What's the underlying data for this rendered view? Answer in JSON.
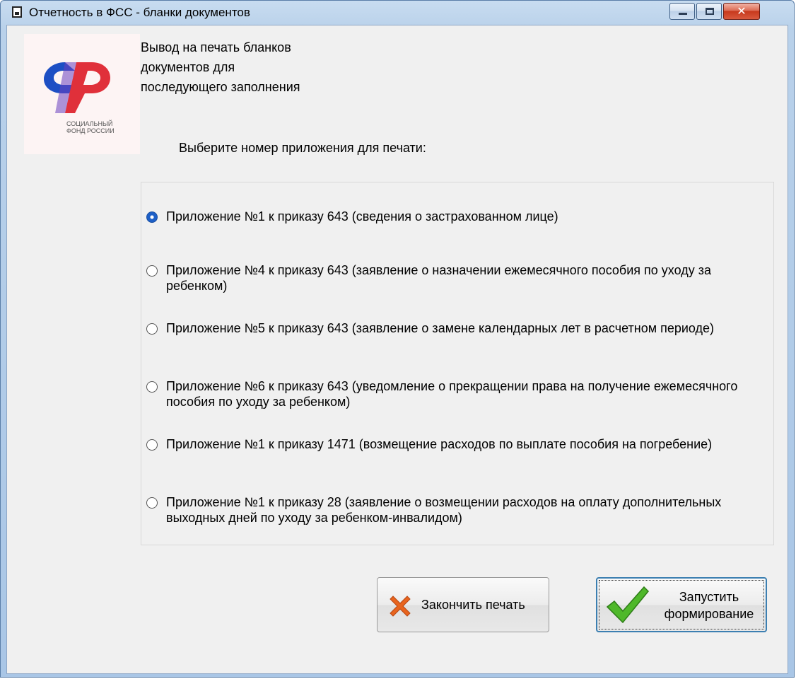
{
  "window": {
    "title": "Отчетность в ФСС - бланки документов",
    "controls": {
      "minimize": "—",
      "maximize": "☐",
      "close": "✕"
    }
  },
  "logo": {
    "caption_line1": "СОЦИАЛЬНЫЙ",
    "caption_line2": "ФОНД РОССИИ",
    "colors": {
      "blue": "#1d4fc4",
      "red": "#e0303a"
    }
  },
  "intro": {
    "line1": "Вывод на печать бланков",
    "line2": "документов для",
    "line3": "последующего заполнения"
  },
  "prompt": "Выберите номер приложения для печати:",
  "options": [
    {
      "label": "Приложение №1 к приказу 643 (сведения о застрахованном лице)",
      "checked": true
    },
    {
      "label": "Приложение №4 к приказу 643 (заявление о назначении ежемесячного пособия по уходу за ребенком)",
      "checked": false
    },
    {
      "label": "Приложение №5 к приказу 643 (заявление о замене календарных лет в расчетном периоде)",
      "checked": false
    },
    {
      "label": "Приложение №6 к приказу 643 (уведомление о прекращении права на получение ежемесячного пособия по уходу за ребенком)",
      "checked": false
    },
    {
      "label": "Приложение №1 к приказу 1471 (возмещение расходов по выплате пособия на погребение)",
      "checked": false
    },
    {
      "label": "Приложение №1 к приказу 28 (заявление о возмещении расходов на оплату дополнительных выходных дней по уходу за ребенком-инвалидом)",
      "checked": false
    }
  ],
  "buttons": {
    "stop": {
      "label": "Закончить печать",
      "icon": "cross-icon",
      "color": "#e8641e"
    },
    "start": {
      "label_line1": "Запустить",
      "label_line2": "формирование",
      "icon": "checkmark-icon",
      "color": "#4fb82a"
    }
  }
}
